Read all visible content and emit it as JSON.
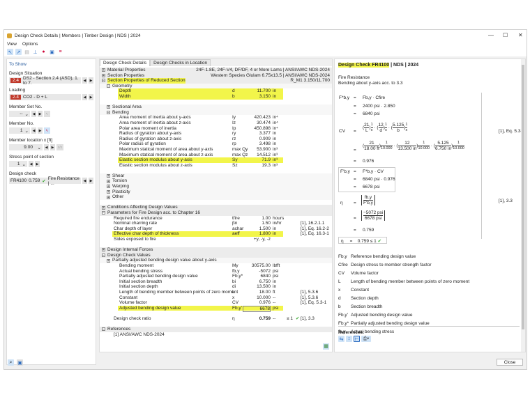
{
  "window": {
    "title": "Design Check Details | Members | Timber Design | NDS | 2024"
  },
  "menu": [
    "View",
    "Options"
  ],
  "left": {
    "header": "To Show",
    "design_situation": {
      "label": "Design Situation",
      "badge": "2.4",
      "value": "DS2 - Section 2.4 (ASD), 1. to 7."
    },
    "loading": {
      "label": "Loading",
      "badge": "2.4",
      "value": "CO2 - D + L"
    },
    "member_set": {
      "label": "Member Set No.",
      "value": "--"
    },
    "member": {
      "label": "Member No.",
      "value": "1"
    },
    "location": {
      "label": "Member location x [ft]",
      "value": "9.00"
    },
    "stress_point": {
      "label": "Stress point of section",
      "value": "1"
    },
    "design_check": {
      "label": "Design check",
      "id": "FR4100",
      "ratio": "0.759",
      "type": "Fire Resistance | ..."
    }
  },
  "tabs": [
    "Design Check Details",
    "Design Checks in Location"
  ],
  "rows": [
    {
      "t": "g",
      "l": "Material Properties",
      "v": "24F-1.8E, 24F-V4, DF/DF, 4 or More Lams | ANSI/AWC NDS-2024",
      "e": false
    },
    {
      "t": "g",
      "l": "Section Properties",
      "v": "Western Species Glulam 6.75x13.5 | ANSI/AWC NDS-2024",
      "e": false
    },
    {
      "t": "g",
      "l": "Section Properties of Reduced Section",
      "v": "R_M1 3.150/11.700",
      "e": true,
      "hl": true
    },
    {
      "t": "s",
      "l": "Geometry",
      "e": true
    },
    {
      "t": "i",
      "l": "Depth",
      "s": "d",
      "v": "11.700",
      "u": "in",
      "hl": true
    },
    {
      "t": "i",
      "l": "Width",
      "s": "b",
      "v": "3.150",
      "u": "in",
      "hl": true
    },
    {
      "t": "b"
    },
    {
      "t": "s",
      "l": "Sectional Area",
      "e": false
    },
    {
      "t": "s",
      "l": "Bending",
      "e": true
    },
    {
      "t": "i",
      "l": "Area moment of inertia about y-axis",
      "s": "Iy",
      "v": "420.423",
      "u": "in⁴"
    },
    {
      "t": "i",
      "l": "Area moment of inertia about z-axis",
      "s": "Iz",
      "v": "30.474",
      "u": "in⁴"
    },
    {
      "t": "i",
      "l": "Polar area moment of inertia",
      "s": "Ip",
      "v": "450.898",
      "u": "in⁴"
    },
    {
      "t": "i",
      "l": "Radius of gyration about y-axis",
      "s": "ry",
      "v": "3.377",
      "u": "in"
    },
    {
      "t": "i",
      "l": "Radius of gyration about z-axis",
      "s": "rz",
      "v": "0.909",
      "u": "in"
    },
    {
      "t": "i",
      "l": "Polar radius of gyration",
      "s": "rp",
      "v": "3.498",
      "u": "in"
    },
    {
      "t": "i",
      "l": "Maximum statical moment of area about y-axis",
      "s": "max Qy",
      "v": "53.900",
      "u": "in³"
    },
    {
      "t": "i",
      "l": "Maximum statical moment of area about z-axis",
      "s": "max Qz",
      "v": "14.512",
      "u": "in³"
    },
    {
      "t": "i",
      "l": "Elastic section modulus about y-axis",
      "s": "Sy",
      "v": "71.9",
      "u": "in³",
      "hl": true
    },
    {
      "t": "i",
      "l": "Elastic section modulus about z-axis",
      "s": "Sz",
      "v": "19.3",
      "u": "in³"
    },
    {
      "t": "b"
    },
    {
      "t": "s",
      "l": "Shear",
      "e": false
    },
    {
      "t": "s",
      "l": "Torsion",
      "e": false
    },
    {
      "t": "s",
      "l": "Warping",
      "e": false
    },
    {
      "t": "s",
      "l": "Plasticity",
      "e": false
    },
    {
      "t": "s",
      "l": "Other",
      "e": false
    },
    {
      "t": "b"
    },
    {
      "t": "g",
      "l": "Conditions Affecting Design Values",
      "e": false
    },
    {
      "t": "g",
      "l": "Parameters for Fire Design acc. to Chapter 16",
      "e": true
    },
    {
      "t": "i",
      "d": 1,
      "l": "Required fire endurance",
      "s": "tfire",
      "v": "1.00",
      "u": "hours"
    },
    {
      "t": "i",
      "d": 1,
      "l": "Nominal charring rate",
      "s": "βn",
      "v": "1.50",
      "u": "in/hr",
      "r": "[1], 16.2.1.1"
    },
    {
      "t": "i",
      "d": 1,
      "l": "Char depth of layer",
      "s": "achar",
      "v": "1.500",
      "u": "in",
      "r": "[1], Eq. 16.2-2"
    },
    {
      "t": "i",
      "d": 1,
      "l": "Effective char depth of thickness",
      "s": "aeff",
      "v": "1.800",
      "u": "in",
      "r": "[1], Eq. 16.3-1",
      "hl": true
    },
    {
      "t": "i",
      "d": 1,
      "l": "Sides exposed to fire",
      "s": "",
      "v": "+y, -y, -z",
      "u": ""
    },
    {
      "t": "b"
    },
    {
      "t": "g",
      "l": "Design Internal Forces",
      "e": false
    },
    {
      "t": "g",
      "l": "Design Check Values",
      "e": true
    },
    {
      "t": "s",
      "l": "Partially adjusted bending design value about y-axis",
      "e": false
    },
    {
      "t": "i",
      "l": "Bending moment",
      "s": "My",
      "v": "30575.00",
      "u": "lbfft"
    },
    {
      "t": "i",
      "l": "Actual bending stress",
      "s": "fb,y",
      "v": "-5072",
      "u": "psi"
    },
    {
      "t": "i",
      "l": "Partially adjusted bending design value",
      "s": "Fb,y*",
      "v": "6840",
      "u": "psi"
    },
    {
      "t": "i",
      "l": "Initial section breadth",
      "s": "bi",
      "v": "6.750",
      "u": "in"
    },
    {
      "t": "i",
      "l": "Initial section depth",
      "s": "di",
      "v": "13.500",
      "u": "in"
    },
    {
      "t": "i",
      "l": "Length of bending member between points of zero moment",
      "s": "L",
      "v": "18.00",
      "u": "ft",
      "r": "[1], 5.3.6"
    },
    {
      "t": "i",
      "l": "Constant",
      "s": "x",
      "v": "10.000",
      "u": "--",
      "r": "[1], 5.3.6"
    },
    {
      "t": "i",
      "l": "Volume factor",
      "s": "CV",
      "v": "0.976",
      "u": "--",
      "r": "[1], Eq. 5.3-1"
    },
    {
      "t": "i",
      "l": "Adjusted bending design value",
      "s": "Fb,y'",
      "v": "6678",
      "u": "psi",
      "hl": true,
      "box": true
    },
    {
      "t": "b"
    },
    {
      "t": "i",
      "d": 1,
      "l": "Design check ratio",
      "s": "η",
      "v": "0.759",
      "u": "--",
      "x": "≤ 1",
      "ok": true,
      "r": "[1], 3.3",
      "bold": true
    },
    {
      "t": "b"
    },
    {
      "t": "g",
      "l": "References",
      "e": true
    },
    {
      "t": "i",
      "d": 1,
      "l": "[1]  ANSI/AWC NDS-2024",
      "s": "",
      "v": "",
      "u": ""
    }
  ],
  "right": {
    "title_hl": "Design Check FR4100",
    "title_rest": " | NDS | 2024",
    "subtitle1": "Fire Resistance",
    "subtitle2": "Bending about y-axis acc. to 3.3",
    "eq1": {
      "lhs": "F*b,y",
      "l1": "Fb,y · Cfire",
      "l2": "2400 psi · 2.850",
      "l3": "6840 psi"
    },
    "eq2": {
      "lhs": "CV",
      "ref": "[1], Eq. 5.3-1",
      "result": "0.976",
      "n1": "21",
      "d1": "L",
      "n2": "12",
      "d2": "d",
      "n3": "5.125",
      "d3": "b",
      "exp_n": "1",
      "exp_d": "x",
      "d1v": "18.00 ft",
      "d2v": "13.500 in",
      "d3v": "6.750 in",
      "xv": "10.000"
    },
    "eq3": {
      "lhs": "F'b,y",
      "l1": "F*b,y · CV",
      "l2": "6840 psi · 0.976",
      "l3": "6678 psi"
    },
    "eq4": {
      "lhs": "η",
      "ref": "[1], 3.3",
      "n": "fb,y",
      "d": "F'b,y",
      "nv": "−5072 psi",
      "dv": "6678 psi",
      "result": "0.759"
    },
    "final": {
      "lhs": "η",
      "eq": "=",
      "val": "0.759",
      "cmp": "≤ 1"
    },
    "eqsign": "=",
    "legend": [
      {
        "s": "Fb,y",
        "d": "Reference bending design value"
      },
      {
        "s": "Cfire",
        "d": "Design stress to member strength factor"
      },
      {
        "s": "CV",
        "d": "Volume factor"
      },
      {
        "s": "L",
        "d": "Length of bending member between points of zero moment"
      },
      {
        "s": "x",
        "d": "Constant"
      },
      {
        "s": "d",
        "d": "Section depth"
      },
      {
        "s": "b",
        "d": "Section breadth"
      },
      {
        "s": "Fb,y'",
        "d": "Adjusted bending design value"
      },
      {
        "s": "Fb,y*",
        "d": "Partially adjusted bending design value"
      },
      {
        "s": "fb,y",
        "d": "Actual bending stress"
      }
    ],
    "references_label": "References:"
  },
  "buttons": {
    "close": "Close"
  }
}
